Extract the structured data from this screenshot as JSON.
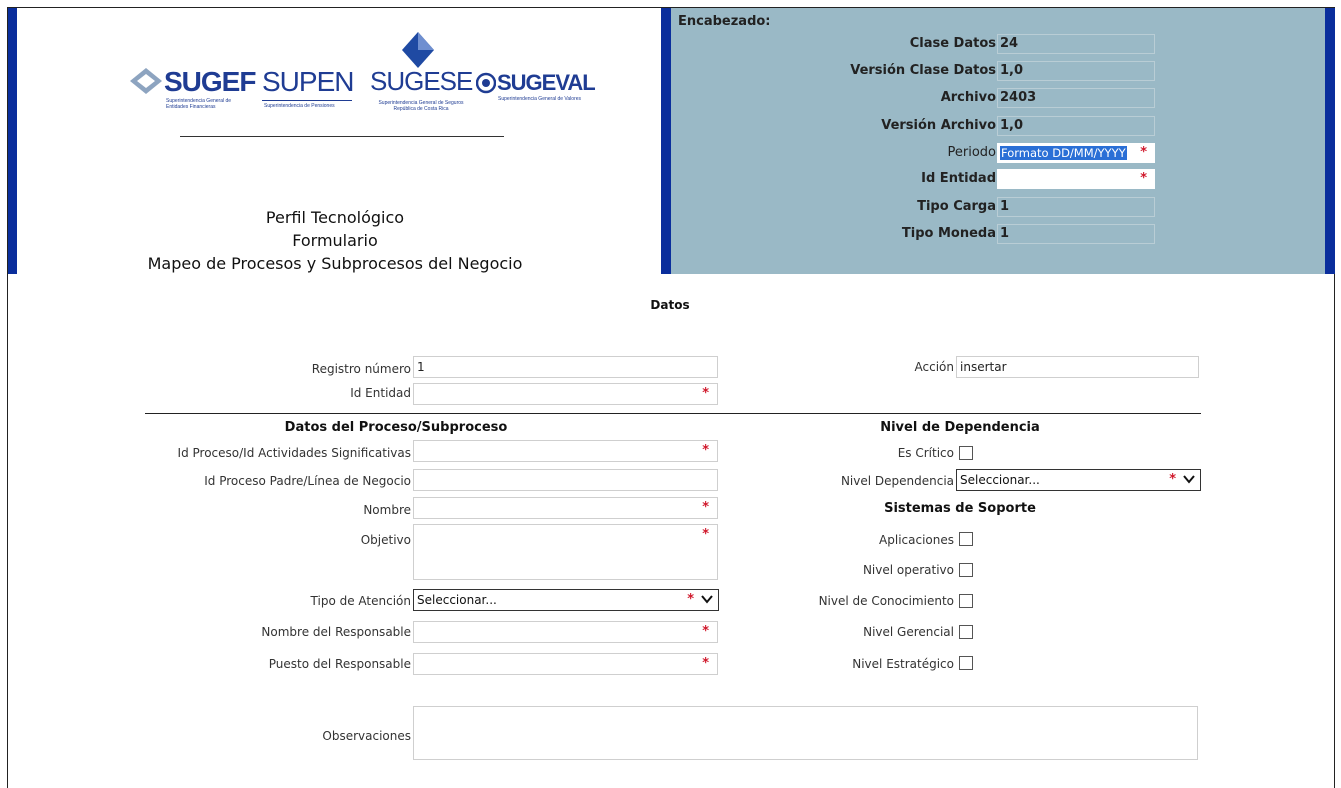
{
  "header": {
    "titles": [
      "Perfil Tecnológico",
      "Formulario",
      "Mapeo de Procesos y Subprocesos del Negocio"
    ],
    "logos": {
      "sugef": {
        "name": "SUGEF",
        "sub": "Superintendencia General de Entidades Financieras"
      },
      "supen": {
        "name": "SUPEN",
        "sub": "Superintendencia de Pensiones"
      },
      "sugese": {
        "name": "SUGESE",
        "sub": "Superintendencia General de Seguros República de Costa Rica"
      },
      "sugeval": {
        "name": "SUGEVAL",
        "sub": "Superintendencia General de Valores"
      }
    },
    "encabezado_label": "Encabezado:",
    "fields": [
      {
        "label": "Clase Datos",
        "value": "24"
      },
      {
        "label": "Versión Clase Datos",
        "value": "1,0"
      },
      {
        "label": "Archivo",
        "value": "2403"
      },
      {
        "label": "Versión Archivo",
        "value": "1,0"
      },
      {
        "label": "Periodo",
        "placeholder": "Formato DD/MM/YYYY",
        "required": "*"
      },
      {
        "label": "Id Entidad",
        "value": "",
        "required": "*"
      },
      {
        "label": "Tipo Carga",
        "value": "1"
      },
      {
        "label": "Tipo Moneda",
        "value": "1"
      }
    ]
  },
  "form": {
    "section_title": "Datos",
    "registro_label": "Registro número",
    "registro_value": "1",
    "id_entidad_label": "Id Entidad",
    "accion_label": "Acción",
    "accion_value": "insertar",
    "left_section": "Datos del Proceso/Subproceso",
    "right_section": "Nivel de Dependencia",
    "id_proceso_label": "Id Proceso/Id Actividades Significativas",
    "id_padre_label": "Id Proceso Padre/Línea de Negocio",
    "nombre_label": "Nombre",
    "objetivo_label": "Objetivo",
    "tipo_atencion_label": "Tipo de Atención",
    "tipo_atencion_value": "Seleccionar...",
    "nombre_resp_label": "Nombre del Responsable",
    "puesto_resp_label": "Puesto del Responsable",
    "observaciones_label": "Observaciones",
    "es_critico_label": "Es Crítico",
    "nivel_dep_label": "Nivel Dependencia",
    "nivel_dep_value": "Seleccionar...",
    "sistemas_section": "Sistemas de Soporte",
    "aplicaciones_label": "Aplicaciones",
    "nivel_operativo_label": "Nivel operativo",
    "nivel_conocimiento_label": "Nivel de Conocimiento",
    "nivel_gerencial_label": "Nivel Gerencial",
    "nivel_estrategico_label": "Nivel Estratégico",
    "required": "*"
  },
  "colors": {
    "header_bg": "#9ab9c6",
    "accent_bar": "#0a2e9c",
    "required": "#d0182b",
    "logo": "#1f3c93"
  }
}
